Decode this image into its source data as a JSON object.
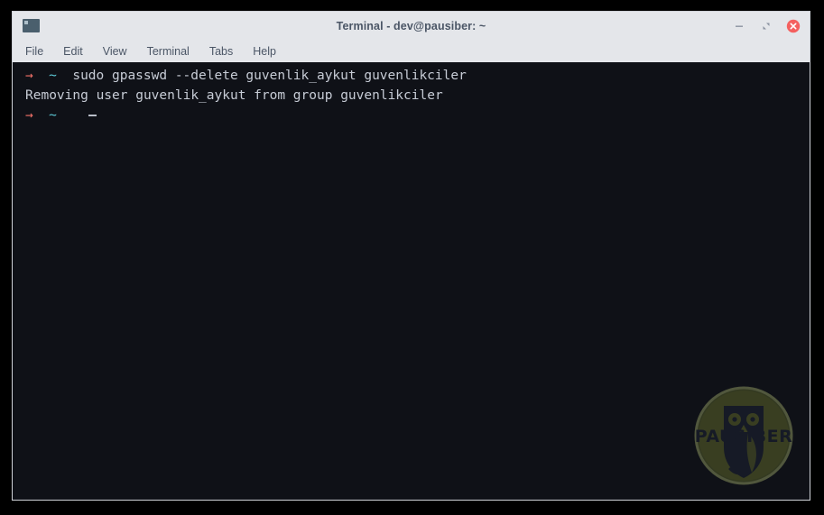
{
  "window": {
    "title": "Terminal - dev@pausiber: ~",
    "app_icon": "terminal-icon",
    "controls": [
      {
        "name": "minimize-button",
        "icon": "minus-icon",
        "label": "–"
      },
      {
        "name": "maximize-button",
        "icon": "restore-icon",
        "label": "❐"
      },
      {
        "name": "close-button",
        "icon": "close-circle-icon",
        "label": "✕"
      }
    ],
    "accent_close_color": "#f4605f"
  },
  "menubar": {
    "items": [
      {
        "label": "File",
        "name": "menu-file"
      },
      {
        "label": "Edit",
        "name": "menu-edit"
      },
      {
        "label": "View",
        "name": "menu-view"
      },
      {
        "label": "Terminal",
        "name": "menu-terminal"
      },
      {
        "label": "Tabs",
        "name": "menu-tabs"
      },
      {
        "label": "Help",
        "name": "menu-help"
      }
    ]
  },
  "terminal": {
    "background_color": "#0f1117",
    "text_color": "#c7ccd6",
    "prompt_arrow_color": "#f4726a",
    "prompt_tilde_color": "#5cc9d6",
    "prompt_arrow": "→",
    "prompt_tilde": "~",
    "lines": [
      {
        "type": "command",
        "arrow": "→",
        "tilde": "~",
        "text": "sudo gpasswd --delete guvenlik_aykut guvenlikciler"
      },
      {
        "type": "output",
        "text": "Removing user guvenlik_aykut from group guvenlikciler"
      },
      {
        "type": "prompt",
        "arrow": "→",
        "tilde": "~",
        "text": ""
      }
    ]
  },
  "watermark": {
    "name": "pausiber-owl-logo",
    "text": "PAUSIBER",
    "circle_color": "#535b28",
    "ring_color": "#6b7436",
    "owl_color": "#1b2130"
  }
}
